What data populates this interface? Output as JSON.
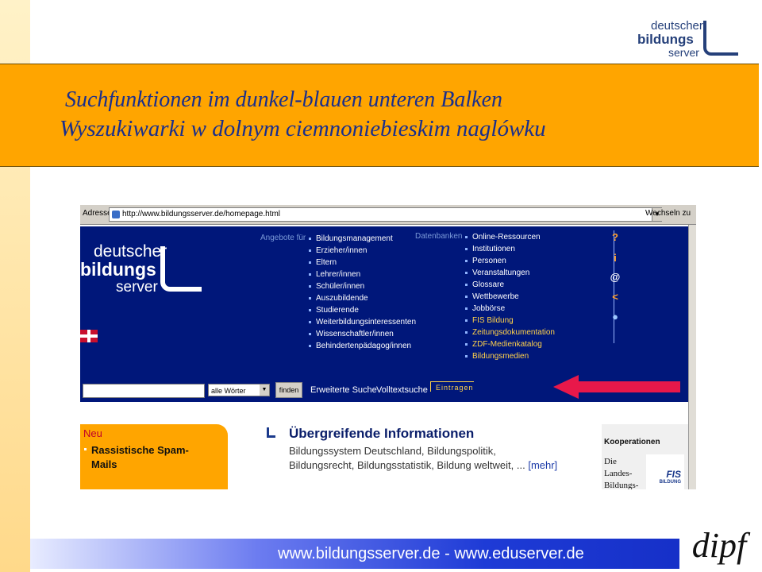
{
  "slide": {
    "title_de": "Suchfunktionen im dunkel-blauen unteren Balken",
    "title_pl": "Wyszukiwarki w dolnym ciemnoniebieskim naglówku",
    "footer_text": "www.bildungsserver.de  -  www.eduserver.de",
    "logo": {
      "line1": "deutscher",
      "line2": "bildungs",
      "line3": "server"
    },
    "dipf_logo": "dipf"
  },
  "browser": {
    "address_label": "Adresse",
    "url": "http://www.bildungsserver.de/homepage.html",
    "go_label": "Wechseln zu"
  },
  "site": {
    "logo": {
      "line1": "deutscher",
      "line2": "bildungs",
      "line3": "server"
    },
    "angebote_label": "Angebote für",
    "angebote_items": [
      "Bildungsmanagement",
      "Erzieher/innen",
      "Eltern",
      "Lehrer/innen",
      "Schüler/innen",
      "Auszubildende",
      "Studierende",
      "Weiterbildungsinteressenten",
      "Wissenschaftler/innen",
      "Behindertenpädagog/innen"
    ],
    "datenbanken_label": "Datenbanken",
    "datenbanken_items": [
      "Online-Ressourcen",
      "Institutionen",
      "Personen",
      "Veranstaltungen",
      "Glossare",
      "Wettbewerbe",
      "Jobbörse"
    ],
    "datenbanken_items_highlight": [
      "FIS Bildung",
      "Zeitungsdokumentation",
      "ZDF-Medienkatalog",
      "Bildungsmedien"
    ],
    "side_icons": [
      "help-icon",
      "info-icon",
      "contact-icon",
      "sitemap-icon",
      "globe-icon"
    ],
    "search": {
      "input_value": "",
      "select_value": "alle Wörter",
      "button_label": "finden",
      "advanced_link": "Erweiterte Suche",
      "fulltext_link": "Volltextsuche",
      "eintragen_link": "Eintragen"
    },
    "neu": {
      "heading": "Neu",
      "item": "Rassistische Spam-Mails"
    },
    "info": {
      "heading": "Übergreifende Informationen",
      "text": "Bildungssystem Deutschland, Bildungspolitik, Bildungsrecht, Bildungsstatistik, Bildung weltweit, ...",
      "more_link": "[mehr]"
    },
    "kooperationen": {
      "heading": "Kooperationen",
      "text": "Die Landes-Bildungs-",
      "fis_logo": "FIS",
      "fis_sub": "BILDUNG"
    }
  },
  "colors": {
    "navy": "#00177a",
    "orange": "#ffa500",
    "arrow": "#e8184a",
    "title": "#1a2f8c"
  }
}
